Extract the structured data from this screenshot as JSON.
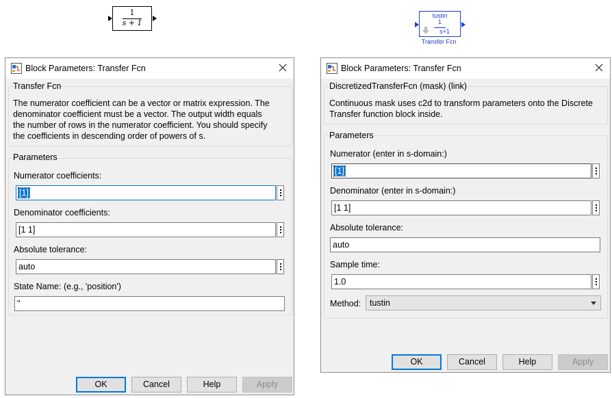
{
  "canvas": {
    "tf_block": {
      "numerator": "1",
      "denominator": "s + 1"
    },
    "dtf_block": {
      "method": "tustin",
      "numerator": "1",
      "denominator": "s+1",
      "caption": "Transfer Fcn"
    }
  },
  "left_dialog": {
    "title": "Block Parameters: Transfer Fcn",
    "block_type": "Transfer Fcn",
    "description_lines": [
      "The numerator coefficient can be a vector or matrix expression. The",
      "denominator coefficient must be a vector. The output width equals",
      "the number of rows in the numerator coefficient. You should specify",
      "the coefficients in descending order of powers of s."
    ],
    "params_title": "Parameters",
    "numerator_label": "Numerator coefficients:",
    "numerator_value": "[1]",
    "denominator_label": "Denominator coefficients:",
    "denominator_value": "[1 1]",
    "abstol_label": "Absolute tolerance:",
    "abstol_value": "auto",
    "state_label": "State Name: (e.g., 'position')",
    "state_value": "''",
    "buttons": {
      "ok": "OK",
      "cancel": "Cancel",
      "help": "Help",
      "apply": "Apply"
    }
  },
  "right_dialog": {
    "title": "Block Parameters: Transfer Fcn",
    "block_type": "DiscretizedTransferFcn (mask) (link)",
    "description_lines": [
      "Continuous mask uses c2d to transform parameters onto the Discrete",
      "Transfer function block inside."
    ],
    "params_title": "Parameters",
    "numerator_label": "Numerator (enter in s-domain:)",
    "numerator_value": "[1]",
    "denominator_label": "Denominator (enter in s-domain:)",
    "denominator_value": "[1 1]",
    "abstol_label": "Absolute tolerance:",
    "abstol_value": "auto",
    "sample_label": "Sample time:",
    "sample_value": "1.0",
    "method_label": "Method:",
    "method_value": "tustin",
    "buttons": {
      "ok": "OK",
      "cancel": "Cancel",
      "help": "Help",
      "apply": "Apply"
    }
  },
  "colors": {
    "accent": "#0078d7",
    "block_link": "#1a3dcf"
  }
}
